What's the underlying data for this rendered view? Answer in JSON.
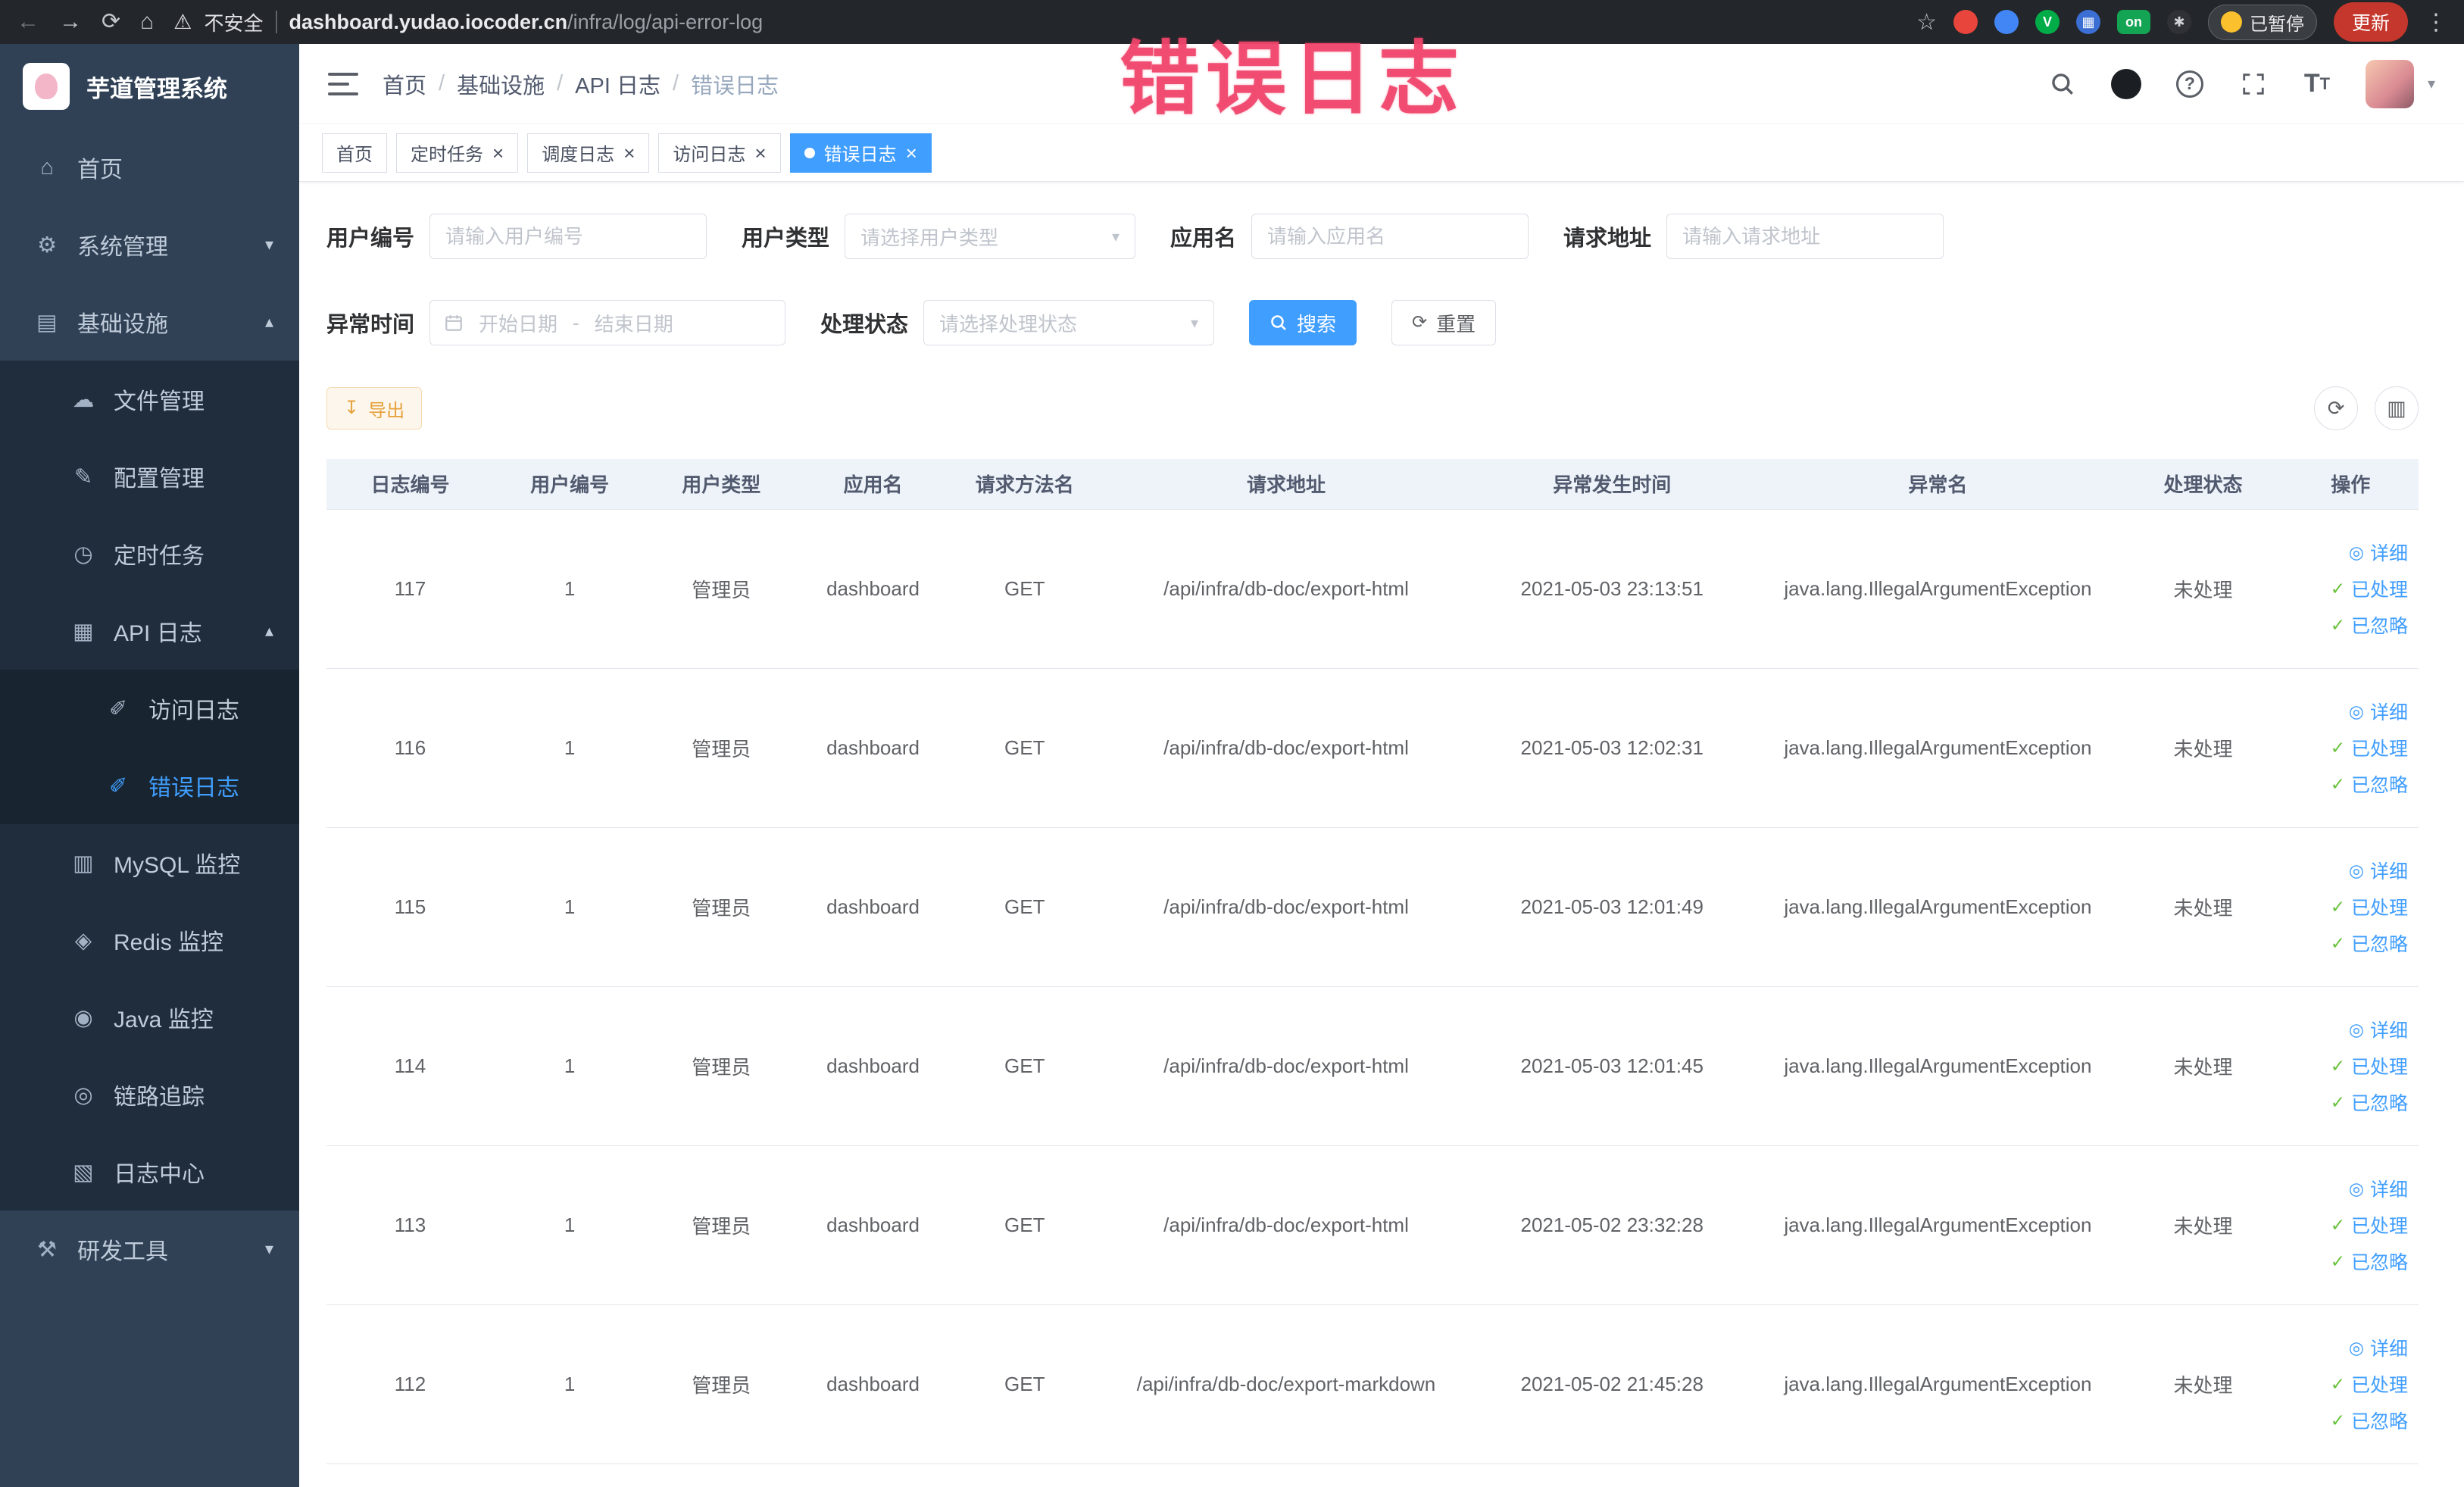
{
  "browser": {
    "security_label": "不安全",
    "url_host": "dashboard.yudao.iocoder.cn",
    "url_path": "/infra/log/api-error-log",
    "paused_label": "已暂停",
    "update_label": "更新"
  },
  "overlay_text": "错误日志",
  "sidebar": {
    "title": "芋道管理系统",
    "items": [
      {
        "label": "首页",
        "icon": "home-icon",
        "level": 1
      },
      {
        "label": "系统管理",
        "icon": "system-icon",
        "level": 1,
        "chevron": "down"
      },
      {
        "label": "基础设施",
        "icon": "infra-icon",
        "level": 1,
        "chevron": "up"
      },
      {
        "label": "文件管理",
        "icon": "file-icon",
        "level": 2
      },
      {
        "label": "配置管理",
        "icon": "config-icon",
        "level": 2
      },
      {
        "label": "定时任务",
        "icon": "job-icon",
        "level": 2
      },
      {
        "label": "API 日志",
        "icon": "api-log-icon",
        "level": 2,
        "chevron": "up"
      },
      {
        "label": "访问日志",
        "icon": "access-log-icon",
        "level": 3
      },
      {
        "label": "错误日志",
        "icon": "error-log-icon",
        "level": 3,
        "active": true
      },
      {
        "label": "MySQL 监控",
        "icon": "mysql-icon",
        "level": 2
      },
      {
        "label": "Redis 监控",
        "icon": "redis-icon",
        "level": 2
      },
      {
        "label": "Java 监控",
        "icon": "java-icon",
        "level": 2
      },
      {
        "label": "链路追踪",
        "icon": "trace-icon",
        "level": 2
      },
      {
        "label": "日志中心",
        "icon": "log-center-icon",
        "level": 2
      },
      {
        "label": "研发工具",
        "icon": "devtools-icon",
        "level": 1,
        "chevron": "down"
      }
    ]
  },
  "breadcrumb": [
    "首页",
    "基础设施",
    "API 日志",
    "错误日志"
  ],
  "tabs": [
    {
      "label": "首页",
      "closable": false,
      "active": false
    },
    {
      "label": "定时任务",
      "closable": true,
      "active": false
    },
    {
      "label": "调度日志",
      "closable": true,
      "active": false
    },
    {
      "label": "访问日志",
      "closable": true,
      "active": false
    },
    {
      "label": "错误日志",
      "closable": true,
      "active": true
    }
  ],
  "filters": {
    "user_id": {
      "label": "用户编号",
      "placeholder": "请输入用户编号"
    },
    "user_type": {
      "label": "用户类型",
      "placeholder": "请选择用户类型"
    },
    "app_name": {
      "label": "应用名",
      "placeholder": "请输入应用名"
    },
    "request_url": {
      "label": "请求地址",
      "placeholder": "请输入请求地址"
    },
    "exception_time": {
      "label": "异常时间",
      "start_placeholder": "开始日期",
      "separator": "-",
      "end_placeholder": "结束日期"
    },
    "process_status": {
      "label": "处理状态",
      "placeholder": "请选择处理状态"
    },
    "search_label": "搜索",
    "reset_label": "重置"
  },
  "toolbar": {
    "export_label": "导出"
  },
  "table": {
    "headers": [
      "日志编号",
      "用户编号",
      "用户类型",
      "应用名",
      "请求方法名",
      "请求地址",
      "异常发生时间",
      "异常名",
      "处理状态",
      "操作"
    ],
    "rows": [
      {
        "log_id": "117",
        "user_id": "1",
        "user_type": "管理员",
        "app_name": "dashboard",
        "method": "GET",
        "url": "/api/infra/db-doc/export-html",
        "time": "2021-05-03 23:13:51",
        "exception": "java.lang.IllegalArgumentException",
        "status": "未处理"
      },
      {
        "log_id": "116",
        "user_id": "1",
        "user_type": "管理员",
        "app_name": "dashboard",
        "method": "GET",
        "url": "/api/infra/db-doc/export-html",
        "time": "2021-05-03 12:02:31",
        "exception": "java.lang.IllegalArgumentException",
        "status": "未处理"
      },
      {
        "log_id": "115",
        "user_id": "1",
        "user_type": "管理员",
        "app_name": "dashboard",
        "method": "GET",
        "url": "/api/infra/db-doc/export-html",
        "time": "2021-05-03 12:01:49",
        "exception": "java.lang.IllegalArgumentException",
        "status": "未处理"
      },
      {
        "log_id": "114",
        "user_id": "1",
        "user_type": "管理员",
        "app_name": "dashboard",
        "method": "GET",
        "url": "/api/infra/db-doc/export-html",
        "time": "2021-05-03 12:01:45",
        "exception": "java.lang.IllegalArgumentException",
        "status": "未处理"
      },
      {
        "log_id": "113",
        "user_id": "1",
        "user_type": "管理员",
        "app_name": "dashboard",
        "method": "GET",
        "url": "/api/infra/db-doc/export-html",
        "time": "2021-05-02 23:32:28",
        "exception": "java.lang.IllegalArgumentException",
        "status": "未处理"
      },
      {
        "log_id": "112",
        "user_id": "1",
        "user_type": "管理员",
        "app_name": "dashboard",
        "method": "GET",
        "url": "/api/infra/db-doc/export-markdown",
        "time": "2021-05-02 21:45:28",
        "exception": "java.lang.IllegalArgumentException",
        "status": "未处理"
      }
    ],
    "row_actions": [
      {
        "label": "详细",
        "icon": "eye-icon"
      },
      {
        "label": "已处理",
        "icon": "check-icon"
      },
      {
        "label": "已忽略",
        "icon": "check-icon"
      }
    ]
  },
  "colors": {
    "accent": "#409EFF",
    "warning": "#E6A23C",
    "success": "#67C23A",
    "sidebar_bg": "#304156",
    "submenu_bg": "#1F2D3D"
  }
}
